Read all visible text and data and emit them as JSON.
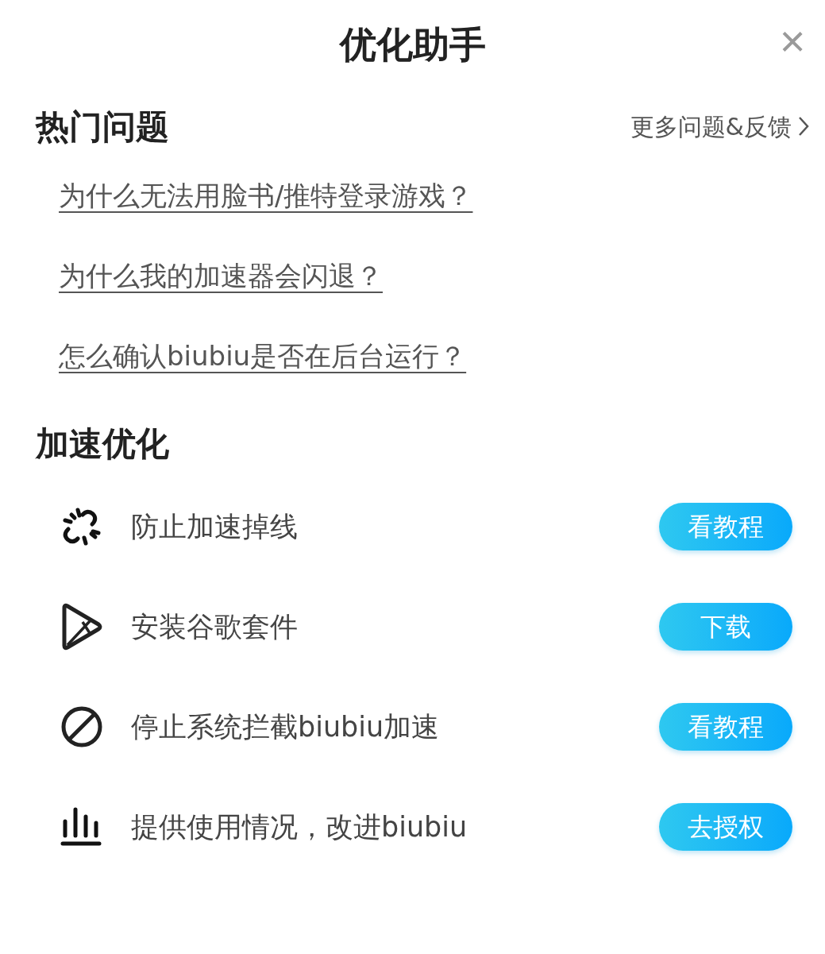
{
  "title": "优化助手",
  "close": "×",
  "faq": {
    "heading": "热门问题",
    "more": "更多问题&反馈",
    "questions": [
      "为什么无法用脸书/推特登录游戏？",
      "为什么我的加速器会闪退？",
      "怎么确认biubiu是否在后台运行？"
    ]
  },
  "optimize": {
    "heading": "加速优化",
    "items": [
      {
        "label": "防止加速掉线",
        "button": "看教程"
      },
      {
        "label": "安装谷歌套件",
        "button": "下载"
      },
      {
        "label": "停止系统拦截biubiu加速",
        "button": "看教程"
      },
      {
        "label": "提供使用情况，改进biubiu",
        "button": "去授权"
      }
    ]
  }
}
